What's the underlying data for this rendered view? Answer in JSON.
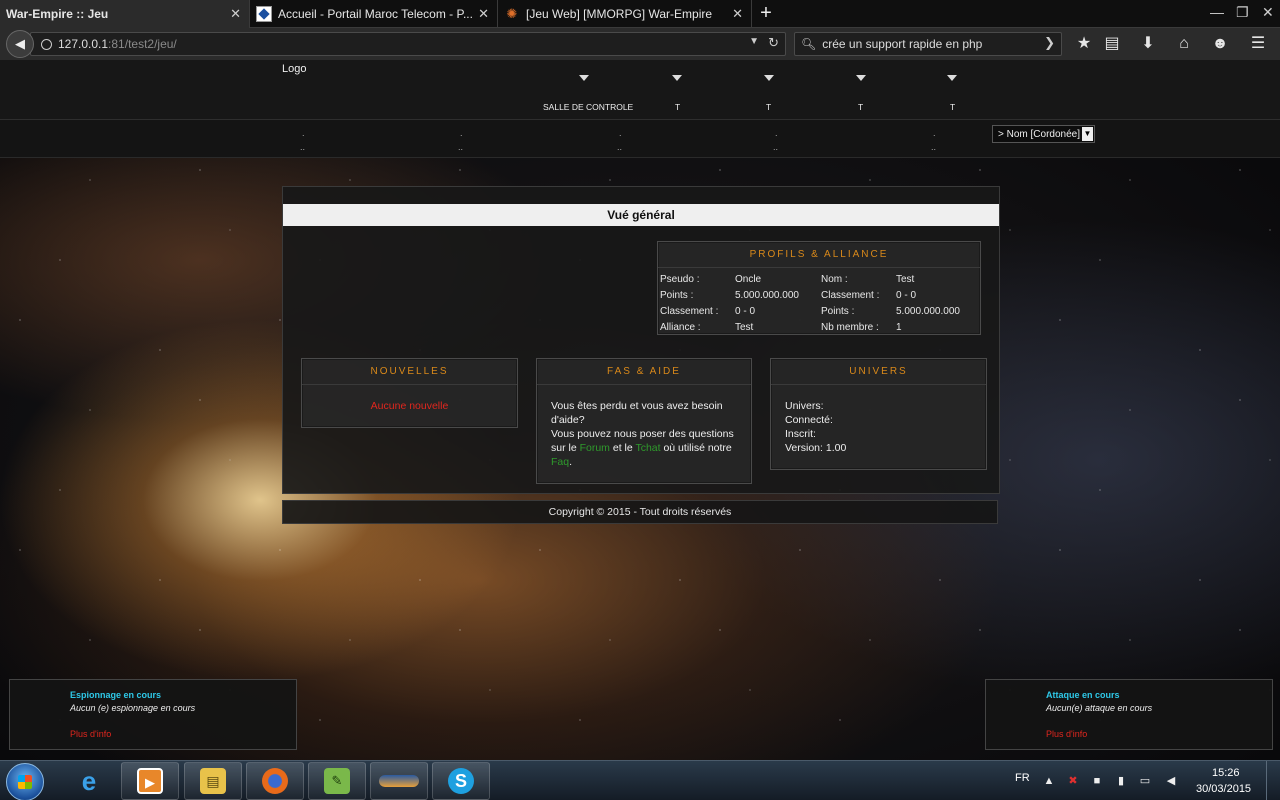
{
  "browser": {
    "tabs": [
      {
        "title": "War-Empire :: Jeu",
        "active": true
      },
      {
        "title": "Accueil - Portail Maroc Telecom - P...",
        "active": false
      },
      {
        "title": "[Jeu Web] [MMORPG] War-Empire",
        "active": false
      }
    ],
    "url_host": "127.0.0.1",
    "url_rest": ":81/test2/jeu/",
    "search_value": "crée un support rapide en php"
  },
  "header": {
    "logo": "Logo",
    "menu": [
      "SALLE DE CONTROLE",
      "T",
      "T",
      "T",
      "T"
    ]
  },
  "subnav": {
    "dots_top": [
      ".",
      ".",
      ".",
      ".",
      "."
    ],
    "dots_bottom": [
      "..",
      "..",
      "..",
      "..",
      ".."
    ],
    "select_value": "> Nom [Cordonée]"
  },
  "main": {
    "title": "Vué général",
    "profile": {
      "title": "PROFILS & ALLIANCE",
      "rows": [
        {
          "l1": "Pseudo :",
          "v1": "Oncle",
          "l2": "Nom :",
          "v2": "Test"
        },
        {
          "l1": "Points :",
          "v1": "5.000.000.000",
          "l2": "Classement :",
          "v2": "0 - 0"
        },
        {
          "l1": "Classement :",
          "v1": "0 - 0",
          "l2": "Points :",
          "v2": "5.000.000.000"
        },
        {
          "l1": "Alliance :",
          "v1": "Test",
          "l2": "Nb membre :",
          "v2": "1"
        }
      ]
    },
    "news": {
      "title": "NOUVELLES",
      "text": "Aucune nouvelle"
    },
    "help": {
      "title": "FAS & AIDE",
      "line1": "Vous êtes perdu et vous avez besoin d'aide?",
      "line2_a": "Vous pouvez nous poser des questions sur le ",
      "forum": "Forum",
      "and": " et le ",
      "tchat": "Tchat",
      "line2_b": " où utilisé notre ",
      "faq": "Faq",
      "end": "."
    },
    "universe": {
      "title": "UNIVERS",
      "lines": [
        "Univers:",
        "Connecté:",
        "Inscrit:",
        "Version: 1.00"
      ]
    }
  },
  "footer": "Copyright © 2015 - Tout droits réservés",
  "alerts": {
    "spy": {
      "title": "Espionnage en cours",
      "text": "Aucun (e) espionnage en cours",
      "more": "Plus d'info"
    },
    "attack": {
      "title": "Attaque en cours",
      "text": "Aucun(e) attaque en cours",
      "more": "Plus d'info"
    }
  },
  "taskbar": {
    "lang": "FR",
    "time": "15:26",
    "date": "30/03/2015"
  },
  "colors": {
    "accent_orange": "#d9891a",
    "alert_red": "#e0261e",
    "link_green": "#2f9a2c",
    "alert_cyan": "#2ec8e8"
  }
}
